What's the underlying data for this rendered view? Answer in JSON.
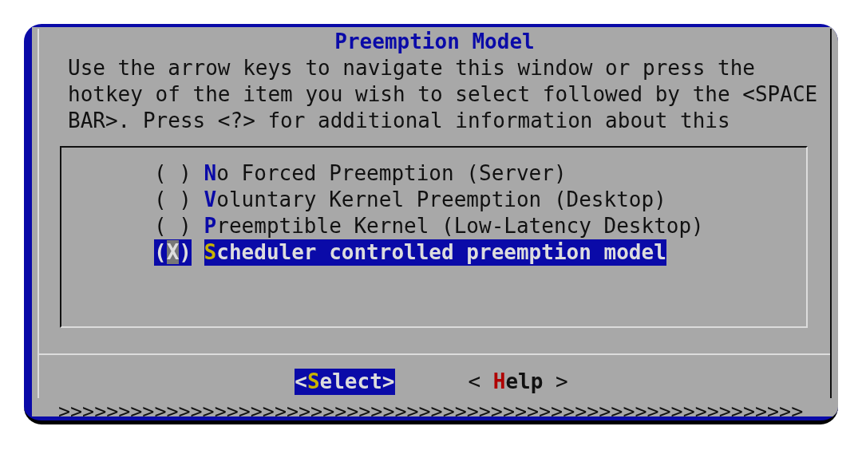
{
  "dialog": {
    "title": "Preemption Model",
    "description_lines": [
      "Use the arrow keys to navigate this window or press the",
      "hotkey of the item you wish to select followed by the <SPACE",
      "BAR>. Press <?> for additional information about this"
    ],
    "options": [
      {
        "marker": "( )",
        "label": "No Forced Preemption (Server)",
        "selected": false
      },
      {
        "marker": "( )",
        "label": "Voluntary Kernel Preemption (Desktop)",
        "selected": false
      },
      {
        "marker": "( )",
        "label": "Preemptible Kernel (Low-Latency Desktop)",
        "selected": false
      },
      {
        "marker": "(X)",
        "label": "Scheduler controlled preemption model",
        "selected": true
      }
    ],
    "buttons": [
      {
        "left": "<",
        "label": "Select",
        "right": ">",
        "selected": true
      },
      {
        "left": "< ",
        "label": "Help",
        "right": " >",
        "selected": false
      }
    ],
    "scroll_indicator": ">>>>>>>>>>>>>>>>>>>>>>>>>>>>>>>>>>>>>>>>>>>>>>>>>>>>>>>>>>>>>>"
  }
}
